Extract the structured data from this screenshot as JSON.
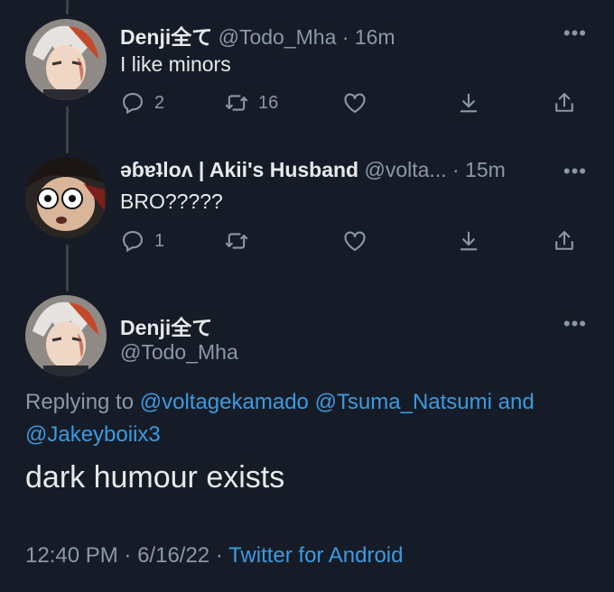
{
  "tweet1": {
    "display_name": "Denji全て",
    "handle": "@Todo_Mha",
    "time": "· 16m",
    "text": "I like minors",
    "reply_count": "2",
    "retweet_count": "16"
  },
  "tweet2": {
    "display_name": "ǝɓɐʇloʌ | Akii's Husband",
    "handle": "@volta...",
    "time": "· 15m",
    "text": "BRO?????",
    "reply_count": "1"
  },
  "main_tweet": {
    "display_name": "Denji全て",
    "handle": "@Todo_Mha",
    "replying_prefix": "Replying to",
    "reply_mention_1": "@voltagekamado",
    "reply_mention_2": "@Tsuma_Natsumi",
    "reply_and": "and",
    "reply_mention_3": "@Jakeyboiix3",
    "text": "dark humour exists",
    "time": "12:40 PM",
    "date": "6/16/22",
    "sep": "·",
    "source": "Twitter for Android"
  },
  "more_glyph": "•••",
  "colors": {
    "background": "#161c27",
    "link": "#3b9ae1",
    "muted": "#8b98a5",
    "text": "#e7e9ea"
  }
}
